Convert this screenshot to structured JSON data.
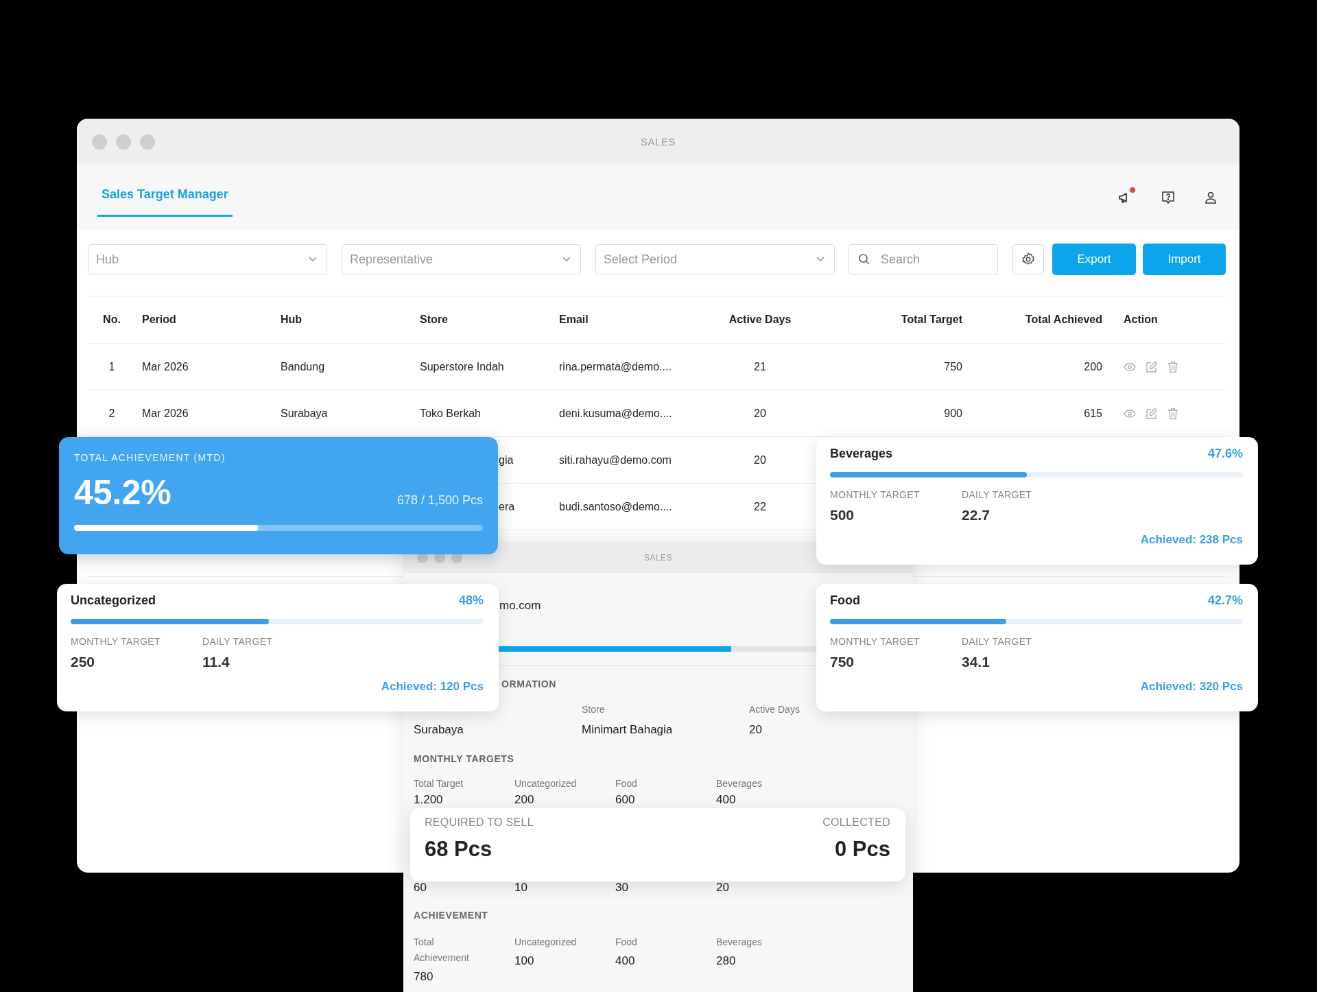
{
  "window": {
    "title": "SALES"
  },
  "tabs": [
    {
      "label": "Sales Target Manager",
      "selected": true
    }
  ],
  "notifications": {
    "unread": true
  },
  "filters": [
    {
      "placeholder": "Hub"
    },
    {
      "placeholder": "Representative"
    },
    {
      "placeholder": "Select Period"
    }
  ],
  "search": {
    "placeholder": "Search"
  },
  "buttons": [
    "Export",
    "Import"
  ],
  "table": {
    "columns": [
      "No.",
      "Period",
      "Hub",
      "Store",
      "Email",
      "Active Days",
      "Total Target",
      "Total Achieved",
      "Action"
    ],
    "rows": [
      {
        "no": "1",
        "period": "Mar 2026",
        "hub": "Bandung",
        "store": "Superstore Indah",
        "email": "rina.permata@demo....",
        "active_days": "21",
        "total_target": "750",
        "total_achieved": "200",
        "actions": true
      },
      {
        "no": "2",
        "period": "Mar 2026",
        "hub": "Surabaya",
        "store": "Toko Berkah",
        "email": "deni.kusuma@demo....",
        "active_days": "20",
        "total_target": "900",
        "total_achieved": "615",
        "actions": true
      },
      {
        "store": "gia",
        "store_cut": true,
        "email": "siti.rahayu@demo.com",
        "active_days": "20"
      },
      {
        "store": "era",
        "store_cut": true,
        "email": "budi.santoso@demo....",
        "active_days": "22"
      }
    ]
  },
  "detail_window": {
    "title": "SALES",
    "email_fragment": "mo.com",
    "progress": {
      "level": 0.65
    },
    "info_title": "ORMATION",
    "info": [
      {
        "value": "Surabaya"
      },
      {
        "label": "Store",
        "value": "Minimart Bahagia"
      },
      {
        "label": "Active Days",
        "value": "20"
      }
    ],
    "monthly_targets": {
      "title": "MONTHLY TARGETS",
      "items": [
        {
          "label": "Total Target",
          "value": "1.200"
        },
        {
          "label": "Uncategorized",
          "value": "200"
        },
        {
          "label": "Food",
          "value": "600"
        },
        {
          "label": "Beverages",
          "value": "400"
        }
      ]
    },
    "partial_values": [
      "60",
      "10",
      "30",
      "20"
    ],
    "achievement": {
      "title": "ACHIEVEMENT",
      "items": [
        {
          "label": "Total Achievement",
          "value": "780"
        },
        {
          "label": "Uncategorized",
          "value": "100"
        },
        {
          "label": "Food",
          "value": "400"
        },
        {
          "label": "Beverages",
          "value": "280"
        }
      ]
    }
  },
  "required_card": {
    "label": "REQUIRED TO SELL",
    "value": "68 Pcs",
    "collected_label": "COLLECTED",
    "collected_value": "0 Pcs"
  },
  "total_card": {
    "label": "TOTAL ACHIEVEMENT (MTD)",
    "percent": "45.2%",
    "ratio": "678 / 1,500 Pcs",
    "level": 0.452
  },
  "category_cards": [
    {
      "name": "Beverages",
      "percent": "47.6%",
      "level": 0.476,
      "monthly_label": "MONTHLY TARGET",
      "monthly": "500",
      "daily_label": "DAILY TARGET",
      "daily": "22.7",
      "achieved": "Achieved: 238 Pcs"
    },
    {
      "name": "Uncategorized",
      "percent": "48%",
      "level": 0.48,
      "monthly_label": "MONTHLY TARGET",
      "monthly": "250",
      "daily_label": "DAILY TARGET",
      "daily": "11.4",
      "achieved": "Achieved: 120 Pcs"
    },
    {
      "name": "Food",
      "percent": "42.7%",
      "level": 0.427,
      "monthly_label": "MONTHLY TARGET",
      "monthly": "750",
      "daily_label": "DAILY TARGET",
      "daily": "34.1",
      "achieved": "Achieved: 320 Pcs"
    }
  ]
}
